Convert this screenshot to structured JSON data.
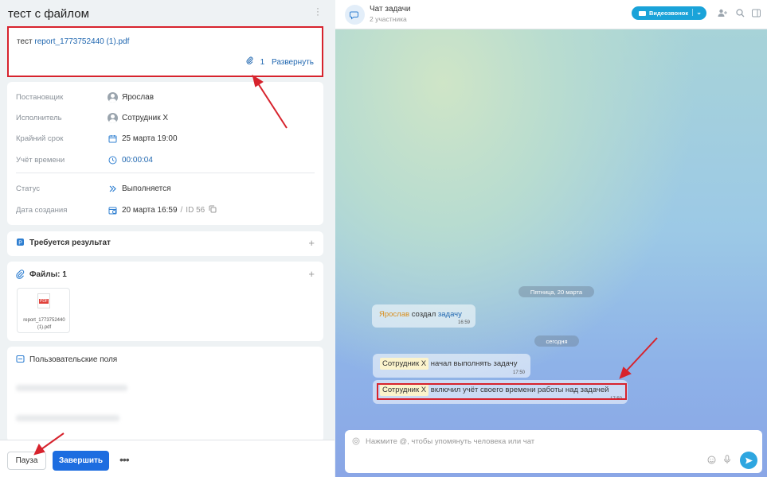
{
  "task": {
    "title": "тест с файлом",
    "description_prefix": "тест ",
    "description_file": "report_1773752440 (1).pdf",
    "attachments_count": "1",
    "expand_label": "Развернуть"
  },
  "info": {
    "creator_label": "Постановщик",
    "creator_value": "Ярослав",
    "assignee_label": "Исполнитель",
    "assignee_value": "Сотрудник Х",
    "deadline_label": "Крайний срок",
    "deadline_value": "25 марта 19:00",
    "time_label": "Учёт времени",
    "time_value": "00:00:04",
    "status_label": "Статус",
    "status_value": "Выполняется",
    "created_label": "Дата создания",
    "created_value": "20 марта 16:59",
    "id_value": "ID 56"
  },
  "sections": {
    "result_title": "Требуется результат",
    "files_title": "Файлы: 1",
    "file_name": "report_1773752440 (1).pdf",
    "custom_fields_title": "Пользовательские поля"
  },
  "actions": {
    "pause": "Пауза",
    "finish": "Завершить",
    "more": "•••"
  },
  "chat": {
    "title": "Чат задачи",
    "subtitle": "2 участника",
    "video_call": "Видеозвонок",
    "date_friday": "Пятница, 20 марта",
    "date_today": "сегодня",
    "msg1_name": "Ярослав",
    "msg1_mid": " создал ",
    "msg1_link": "задачу",
    "msg1_time": "16:59",
    "msg2_name": "Сотрудник Х",
    "msg2_text": " начал выполнять задачу",
    "msg2_time": "17:50",
    "msg3_name": "Сотрудник Х",
    "msg3_text": " включил учёт своего времени работы над задачей",
    "msg3_time": "17:50",
    "input_placeholder": "Нажмите @, чтобы упомянуть человека или чат"
  },
  "colors": {
    "accent": "#1d6de0",
    "link": "#2067b0",
    "annotation": "#d7232d",
    "video_button": "#1aa3d9"
  }
}
